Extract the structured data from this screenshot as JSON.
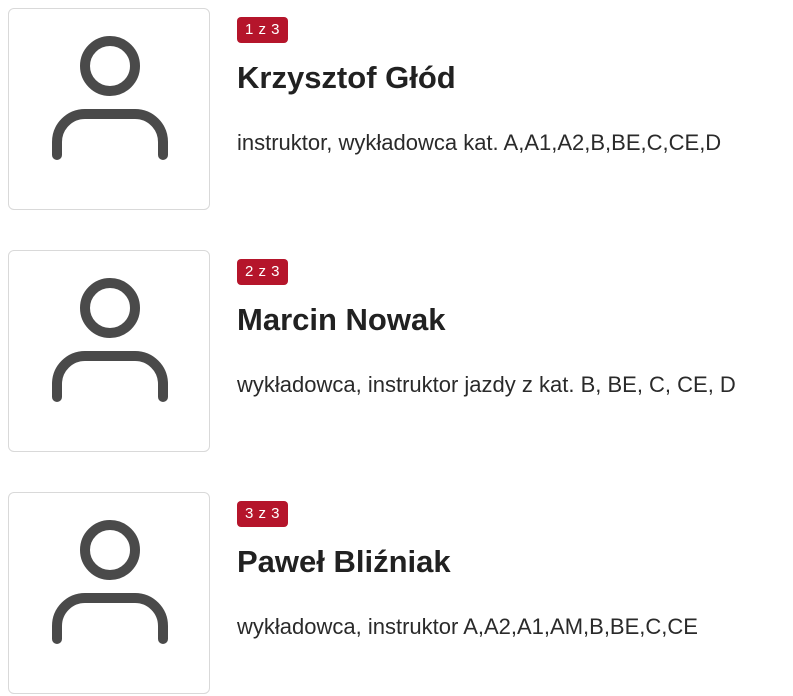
{
  "colors": {
    "badge_background": "#b5152b",
    "badge_text": "#ffffff",
    "avatar_icon": "#4a4a4a",
    "card_border": "#d9d9d9"
  },
  "people": [
    {
      "counter": "1 z 3",
      "name": "Krzysztof Głód",
      "role": "instruktor, wykładowca kat. A,A1,A2,B,BE,C,CE,D",
      "icon": "person-placeholder-icon"
    },
    {
      "counter": "2 z 3",
      "name": "Marcin Nowak",
      "role": "wykładowca, instruktor jazdy z kat. B, BE, C, CE, D",
      "icon": "person-placeholder-icon"
    },
    {
      "counter": "3 z 3",
      "name": "Paweł Bliźniak",
      "role": "wykładowca, instruktor A,A2,A1,AM,B,BE,C,CE",
      "icon": "person-placeholder-icon"
    }
  ]
}
